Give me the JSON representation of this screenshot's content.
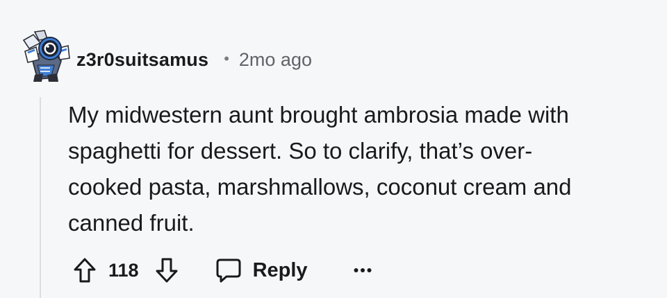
{
  "comment": {
    "username": "z3r0suitsamus",
    "separator": "•",
    "timestamp": "2mo ago",
    "body_lines": [
      "My midwestern aunt brought ambrosia made with",
      "spaghetti for dessert. So to clarify, that’s over-",
      "cooked pasta, marshmallows, coconut cream and",
      "canned fruit."
    ]
  },
  "actions": {
    "vote_count": "118",
    "reply_label": "Reply",
    "upvote_icon": "arrow-up-icon",
    "downvote_icon": "arrow-down-icon",
    "reply_icon": "speech-bubble-icon",
    "more_icon": "ellipsis-icon"
  },
  "colors": {
    "background": "#f6f7f9",
    "text": "#1a1a1b",
    "muted": "#5f6368",
    "thread_line": "#dcdde0"
  }
}
